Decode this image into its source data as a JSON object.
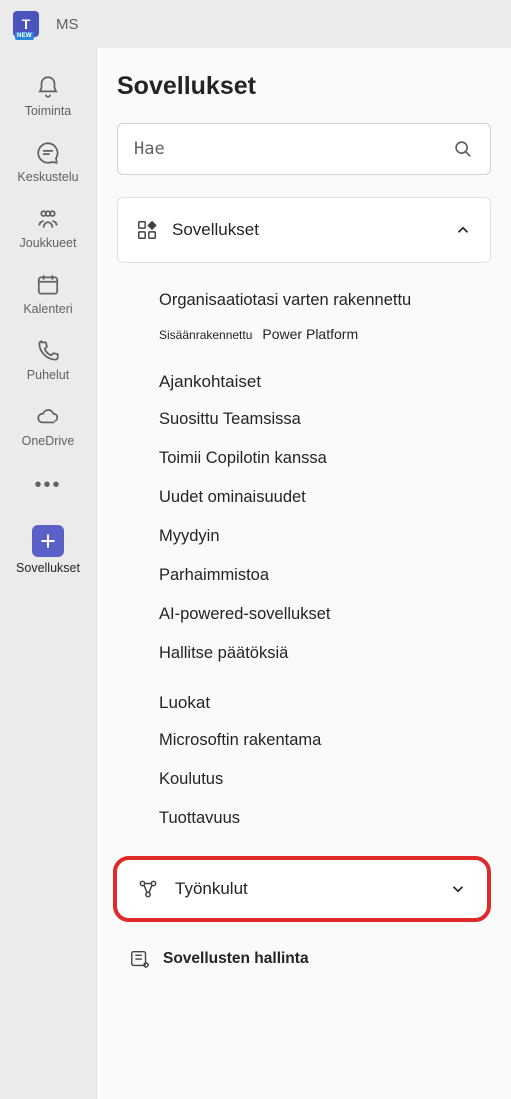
{
  "titlebar": {
    "ms": "MS"
  },
  "rail": {
    "items": [
      {
        "label": "Toiminta"
      },
      {
        "label": "Keskustelu"
      },
      {
        "label": "Joukkueet"
      },
      {
        "label": "Kalenteri"
      },
      {
        "label": "Puhelut"
      },
      {
        "label": "OneDrive"
      }
    ],
    "apps_label": "Sovellukset"
  },
  "main": {
    "title": "Sovellukset",
    "search_placeholder": "Hae",
    "section_head": "Sovellukset",
    "tree": {
      "org_built": "Organisaatiotasi varten rakennettu",
      "builtin": "Sisäänrakennettu",
      "power_platform": "Power Platform",
      "timely": "Ajankohtaiset",
      "popular": "Suosittu Teamsissa",
      "copilot": "Toimii Copilotin kanssa",
      "new_features": "Uudet ominaisuudet",
      "bestseller": "Myydyin",
      "best": "Parhaimmistoa",
      "ai": "AI-powered-sovellukset",
      "decisions": "Hallitse päätöksiä",
      "categories": "Luokat",
      "ms_built": "Microsoftin rakentama",
      "education": "Koulutus",
      "productivity": "Tuottavuus"
    },
    "workflows": "Työnkulut",
    "manage": "Sovellusten hallinta"
  }
}
